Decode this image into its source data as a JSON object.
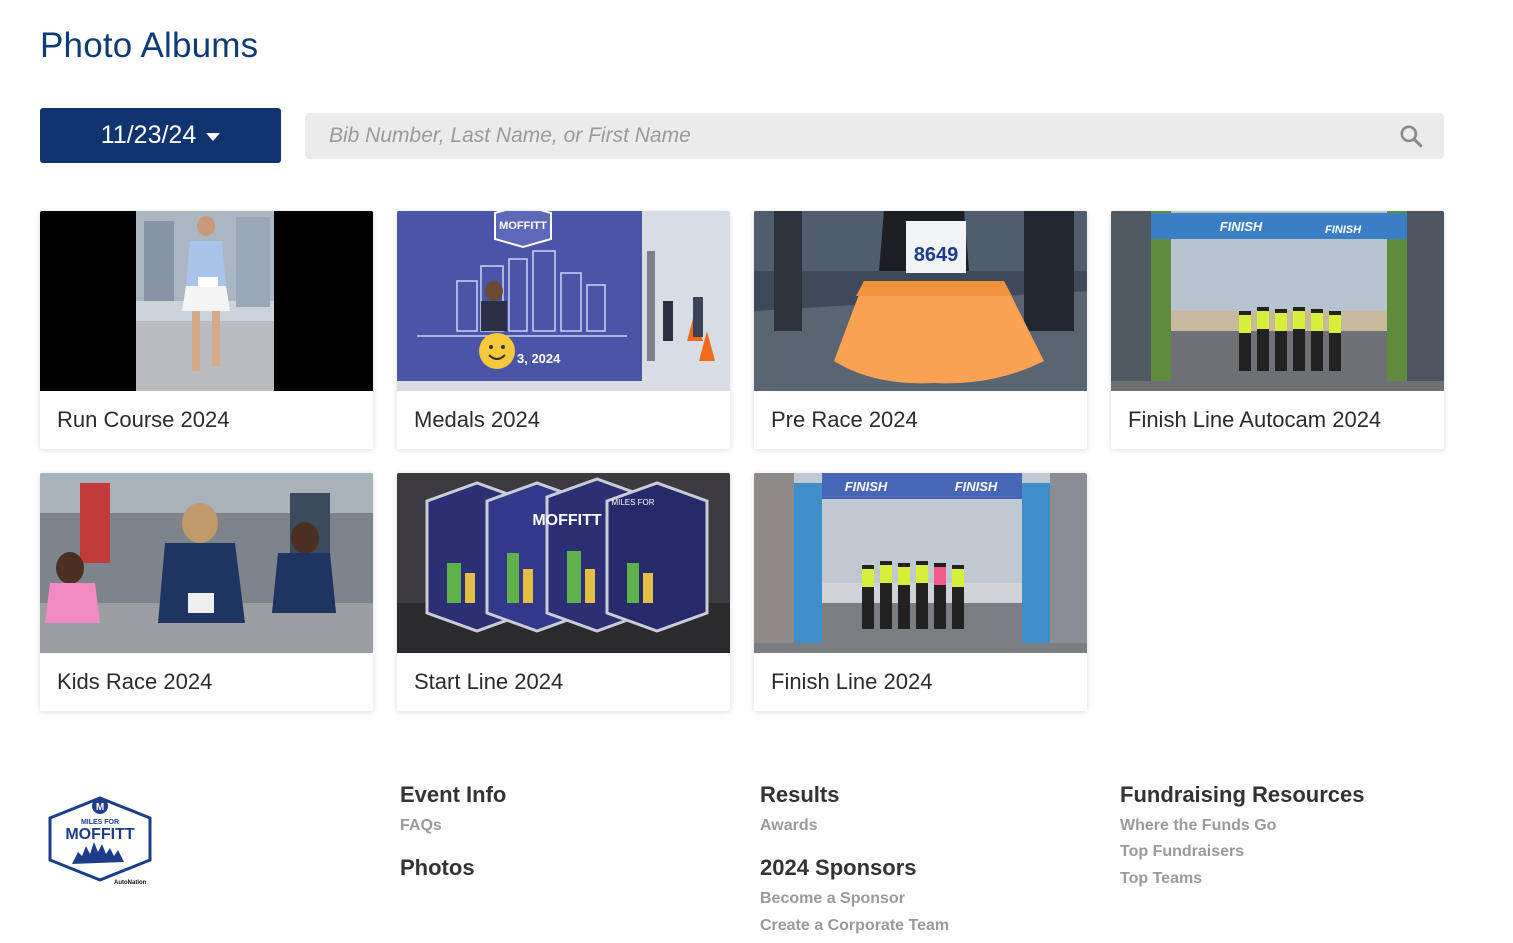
{
  "page_title": "Photo Albums",
  "date_filter": {
    "selected": "11/23/24"
  },
  "search": {
    "placeholder": "Bib Number, Last Name, or First Name",
    "value": ""
  },
  "albums": [
    {
      "label": "Run Course 2024"
    },
    {
      "label": "Medals 2024"
    },
    {
      "label": "Pre Race 2024"
    },
    {
      "label": "Finish Line Autocam 2024"
    },
    {
      "label": "Kids Race 2024"
    },
    {
      "label": "Start Line 2024"
    },
    {
      "label": "Finish Line 2024"
    }
  ],
  "thumb_text": {
    "bib": "8649",
    "finish": "FINISH",
    "moffitt": "MOFFITT",
    "date_fragment": "3, 2024",
    "miles_for": "MILES FOR"
  },
  "footer": {
    "logo": {
      "line1": "MILES FOR",
      "line2": "MOFFITT",
      "powered": "AutoNation"
    },
    "col1": {
      "head1": "Event Info",
      "link1": "FAQs",
      "head2": "Photos"
    },
    "col2": {
      "head1": "Results",
      "link1": "Awards",
      "head2": "2024 Sponsors",
      "link2": "Become a Sponsor",
      "link3": "Create a Corporate Team"
    },
    "col3": {
      "head1": "Fundraising Resources",
      "link1": "Where the Funds Go",
      "link2": "Top Fundraisers",
      "link3": "Top Teams"
    }
  },
  "colors": {
    "brand_navy": "#0f3470",
    "title_blue": "#0f3a78",
    "link_gray": "#9a9a9a"
  }
}
